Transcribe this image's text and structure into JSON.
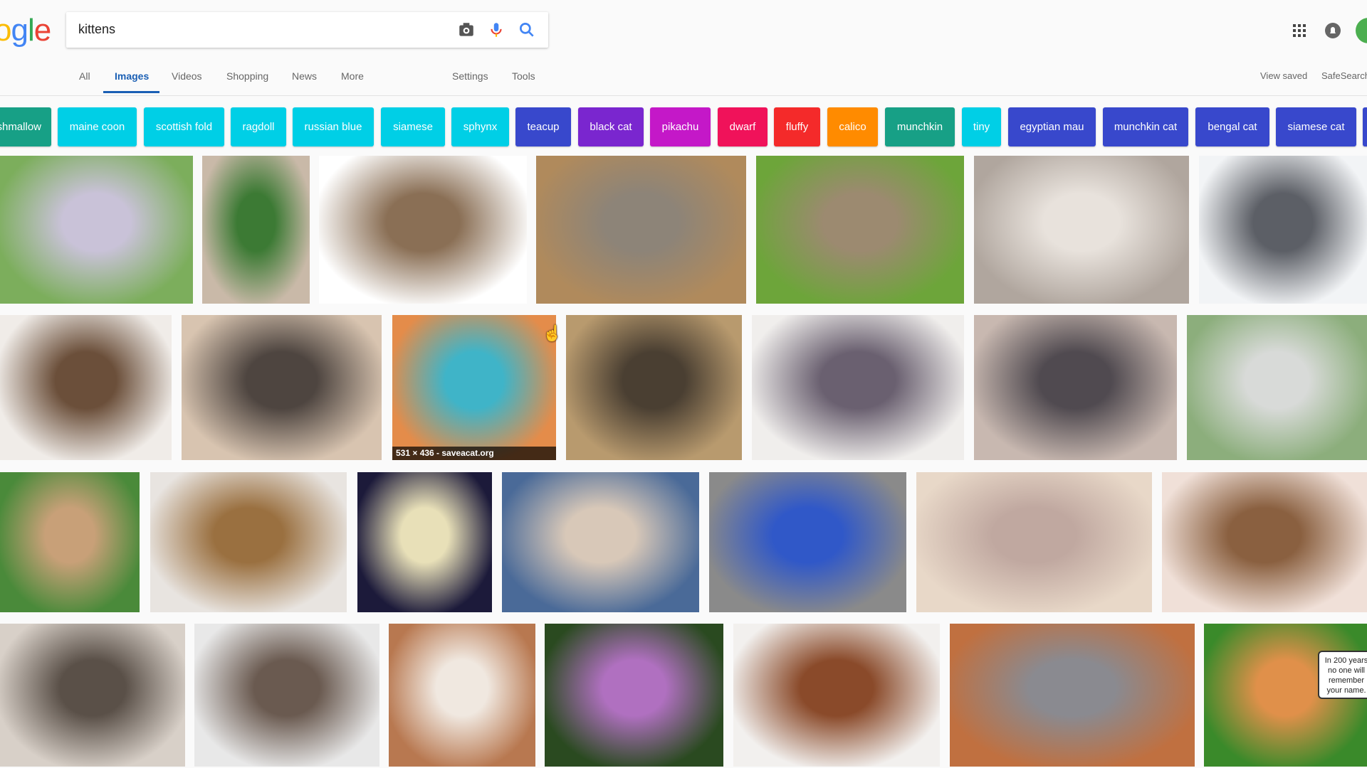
{
  "logo": {
    "text": "ogle",
    "colors": [
      "#4285f4",
      "#fbbc05",
      "#4285f4",
      "#34a853",
      "#ea4335"
    ]
  },
  "search": {
    "query": "kittens",
    "camera_icon": "camera-icon",
    "mic_icon": "microphone-icon",
    "search_icon": "search-icon"
  },
  "header_right": {
    "apps_icon": "apps-grid-icon",
    "notifications_icon": "bell-icon",
    "avatar_color": "#4caf50"
  },
  "tabs": [
    {
      "label": "All"
    },
    {
      "label": "Images",
      "active": true
    },
    {
      "label": "Videos"
    },
    {
      "label": "Shopping"
    },
    {
      "label": "News"
    },
    {
      "label": "More"
    }
  ],
  "tools": {
    "settings": "Settings",
    "tools": "Tools",
    "view_saved": "View saved",
    "safesearch": "SafeSearch"
  },
  "chips": [
    {
      "label": "marshmallow",
      "color": "#17a086"
    },
    {
      "label": "maine coon",
      "color": "#00cfe6"
    },
    {
      "label": "scottish fold",
      "color": "#00cfe6"
    },
    {
      "label": "ragdoll",
      "color": "#00cfe6"
    },
    {
      "label": "russian blue",
      "color": "#00cfe6"
    },
    {
      "label": "siamese",
      "color": "#00cfe6"
    },
    {
      "label": "sphynx",
      "color": "#00cfe6"
    },
    {
      "label": "teacup",
      "color": "#3848cc"
    },
    {
      "label": "black cat",
      "color": "#7a26cf"
    },
    {
      "label": "pikachu",
      "color": "#c418c8"
    },
    {
      "label": "dwarf",
      "color": "#f0125a"
    },
    {
      "label": "fluffy",
      "color": "#f42a2a"
    },
    {
      "label": "calico",
      "color": "#ff8b00"
    },
    {
      "label": "munchkin",
      "color": "#17a086"
    },
    {
      "label": "tiny",
      "color": "#00cfe6"
    },
    {
      "label": "egyptian mau",
      "color": "#3848cc"
    },
    {
      "label": "munchkin cat",
      "color": "#3848cc"
    },
    {
      "label": "bengal cat",
      "color": "#3848cc"
    },
    {
      "label": "siamese cat",
      "color": "#3848cc"
    },
    {
      "label": "",
      "color": "#3848cc"
    }
  ],
  "results": {
    "rows": [
      [
        [
          "#7cae5c",
          "#c9c2d8"
        ],
        [
          "#c9b9a8",
          "#3c7a34"
        ],
        [
          "#ffffff",
          "#8a6f55"
        ],
        [
          "#b08a5c",
          "#8d8478"
        ],
        [
          "#6da53a",
          "#9c8a70"
        ],
        [
          "#b0a69e",
          "#e8e2dc"
        ],
        [
          "#f2f4f6",
          "#5c5f66"
        ]
      ],
      [
        [
          "#f0ece8",
          "#6b4f3a"
        ],
        [
          "#d8c4b0",
          "#4e4540"
        ],
        [
          "#e48c4a",
          "#3fb4c8"
        ],
        [
          "#b89a6e",
          "#4a3f32"
        ],
        [
          "#f0eeec",
          "#6a6070"
        ],
        [
          "#c8b8b0",
          "#504a50"
        ],
        [
          "#8cae7c",
          "#d8dad8"
        ]
      ],
      [
        [
          "#4a8a3a",
          "#c8a078"
        ],
        [
          "#e8e4e0",
          "#9a7040"
        ],
        [
          "#1c1a3a",
          "#e8e0b8"
        ],
        [
          "#4a6a98",
          "#d8c8b8"
        ],
        [
          "#8a8a8a",
          "#3058c8"
        ],
        [
          "#e8d8c8",
          "#c0a8a0"
        ],
        [
          "#f0e0d8",
          "#8a6040"
        ]
      ],
      [
        [
          "#d8d0c8",
          "#5a5048"
        ],
        [
          "#e8e8e8",
          "#6a5a50"
        ],
        [
          "#b87850",
          "#f0e8e0"
        ],
        [
          "#2a4a20",
          "#b070c0"
        ],
        [
          "#f2f0ee",
          "#8a4a2a"
        ],
        [
          "#c07040",
          "#8a8a90"
        ],
        [
          "#3a8a2a",
          "#e0904a"
        ]
      ]
    ],
    "hover_overlay": "531 × 436 - saveacat.org",
    "meme_text": "In 200 years no one will remember your name."
  }
}
